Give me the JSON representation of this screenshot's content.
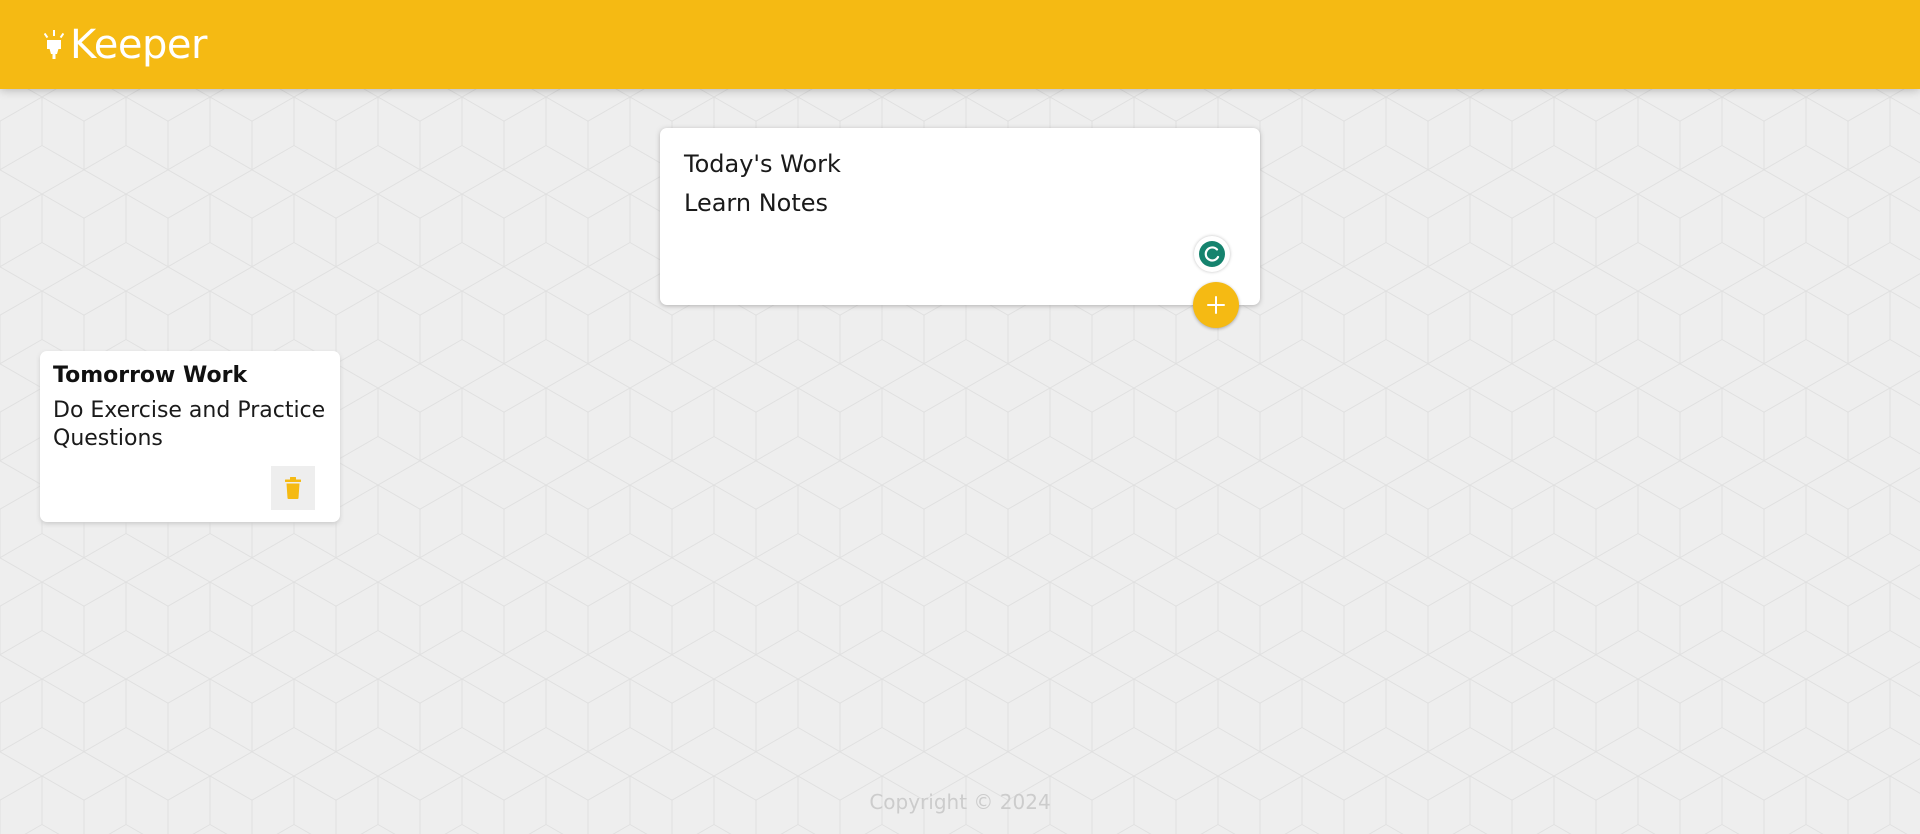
{
  "app": {
    "title": "Keeper",
    "logo_icon": "highlight-icon"
  },
  "create_note": {
    "title_value": "Today's Work",
    "content_value": "Learn Notes",
    "add_button_icon": "add-icon",
    "grammar_icon": "grammarly-icon"
  },
  "notes": [
    {
      "title": "Tomorrow Work",
      "content": "Do Exercise and Practice\nQuestions",
      "delete_icon": "trash-icon"
    }
  ],
  "footer": {
    "text": "Copyright © 2024"
  },
  "colors": {
    "brand": "#f5ba13",
    "background": "#eeeeee",
    "card": "#ffffff",
    "grammar_badge": "#15836e"
  }
}
